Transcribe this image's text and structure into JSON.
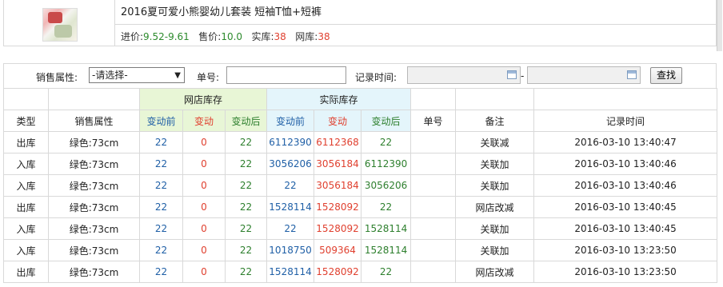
{
  "product": {
    "title": "2016夏可爱小熊婴幼儿套装 短袖T恤+短裤",
    "purchase_label": "进价:",
    "purchase_value": "9.52-9.61",
    "sale_label": "售价:",
    "sale_value": "10.0",
    "real_stock_label": "实库:",
    "real_stock_value": "38",
    "shop_stock_label": "网库:",
    "shop_stock_value": "38",
    "thumbnail_icon": "product-photo"
  },
  "filter": {
    "sales_attr_label": "销售属性:",
    "sales_attr_selected": "-请选择-",
    "order_no_label": "单号:",
    "order_no_value": "",
    "record_time_label": "记录时间:",
    "date_separator": "-",
    "date_from": "",
    "date_to": "",
    "search_button": "查找",
    "calendar_icon": "calendar-icon"
  },
  "table": {
    "group_headers": {
      "shop_stock": "网店库存",
      "real_stock": "实际库存"
    },
    "columns": {
      "type": "类型",
      "attr": "销售属性",
      "shop_before": "变动前",
      "shop_change": "变动",
      "shop_after": "变动后",
      "real_before": "变动前",
      "real_change": "变动",
      "real_after": "变动后",
      "order_no": "单号",
      "note": "备注",
      "time": "记录时间"
    },
    "rows": [
      {
        "type": "出库",
        "attr": "绿色:73cm",
        "shop_before": "22",
        "shop_change": "0",
        "shop_after": "22",
        "real_before": "6112390",
        "real_change": "6112368",
        "real_after": "22",
        "order_no": "",
        "note": "关联减",
        "time": "2016-03-10 13:40:47"
      },
      {
        "type": "入库",
        "attr": "绿色:73cm",
        "shop_before": "22",
        "shop_change": "0",
        "shop_after": "22",
        "real_before": "3056206",
        "real_change": "3056184",
        "real_after": "6112390",
        "order_no": "",
        "note": "关联加",
        "time": "2016-03-10 13:40:46"
      },
      {
        "type": "入库",
        "attr": "绿色:73cm",
        "shop_before": "22",
        "shop_change": "0",
        "shop_after": "22",
        "real_before": "22",
        "real_change": "3056184",
        "real_after": "3056206",
        "order_no": "",
        "note": "关联加",
        "time": "2016-03-10 13:40:46"
      },
      {
        "type": "出库",
        "attr": "绿色:73cm",
        "shop_before": "22",
        "shop_change": "0",
        "shop_after": "22",
        "real_before": "1528114",
        "real_change": "1528092",
        "real_after": "22",
        "order_no": "",
        "note": "网店改减",
        "time": "2016-03-10 13:40:45"
      },
      {
        "type": "入库",
        "attr": "绿色:73cm",
        "shop_before": "22",
        "shop_change": "0",
        "shop_after": "22",
        "real_before": "22",
        "real_change": "1528092",
        "real_after": "1528114",
        "order_no": "",
        "note": "关联加",
        "time": "2016-03-10 13:40:45"
      },
      {
        "type": "入库",
        "attr": "绿色:73cm",
        "shop_before": "22",
        "shop_change": "0",
        "shop_after": "22",
        "real_before": "1018750",
        "real_change": "509364",
        "real_after": "1528114",
        "order_no": "",
        "note": "关联加",
        "time": "2016-03-10 13:23:50"
      },
      {
        "type": "出库",
        "attr": "绿色:73cm",
        "shop_before": "22",
        "shop_change": "0",
        "shop_after": "22",
        "real_before": "1528114",
        "real_change": "1528092",
        "real_after": "22",
        "order_no": "",
        "note": "网店改减",
        "time": "2016-03-10 13:23:50"
      }
    ]
  },
  "colors": {
    "before": "#1f5fa6",
    "change": "#e0402f",
    "after": "#2d7f2d",
    "shop_header_bg": "#e8f6d6",
    "real_header_bg": "#e4f5fb"
  }
}
